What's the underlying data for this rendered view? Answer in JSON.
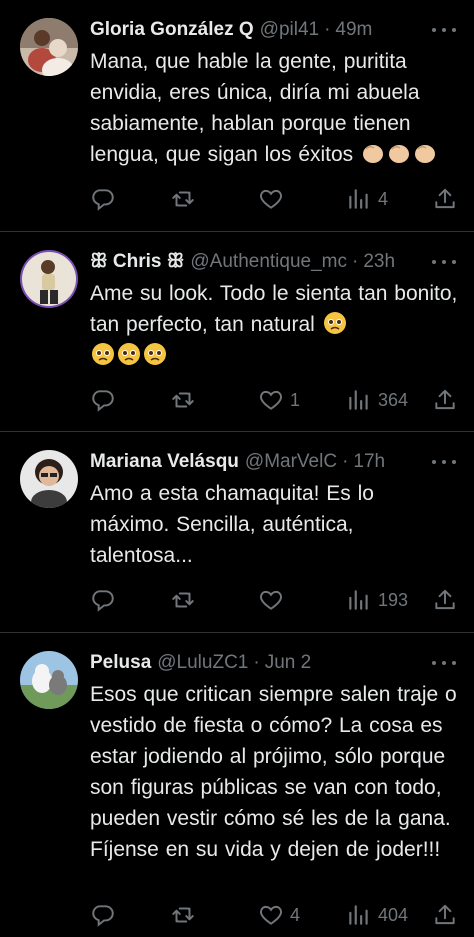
{
  "tweets": [
    {
      "name": "Gloria González Q",
      "handle": "@pil41",
      "time": "49m",
      "text": "Mana, que hable la gente, puritita envidia, eres única, diría mi abuela sabiamente, hablan porque tienen lengua, que sigan los éxitos",
      "emoji": [
        "clapping-hands",
        "clapping-hands",
        "clapping-hands"
      ],
      "replies": "",
      "retweets": "",
      "likes": "",
      "views": "4"
    },
    {
      "name": "ꕥ Chris ꕥ",
      "handle": "@Authentique_mc",
      "time": "23h",
      "text": "Ame su look. Todo le sienta tan bonito, tan perfecto, tan natural",
      "emoji": [
        "pleading-face",
        "pleading-face",
        "pleading-face",
        "pleading-face"
      ],
      "replies": "",
      "retweets": "",
      "likes": "1",
      "views": "364"
    },
    {
      "name": "Mariana Velásqu",
      "handle": "@MarVelC",
      "time": "17h",
      "text": "Amo a esta chamaquita! Es lo máximo. Sencilla, auténtica, talentosa...",
      "emoji": [],
      "replies": "",
      "retweets": "",
      "likes": "",
      "views": "193"
    },
    {
      "name": "Pelusa",
      "handle": "@LuluZC1",
      "time": "Jun 2",
      "text": "Esos que critican siempre salen traje o vestido de fiesta o cómo? La cosa es estar jodiendo al prójimo, sólo porque son figuras públicas se van con todo, pueden vestir cómo sé les de la gana. Fíjense en su vida y dejen de joder!!!",
      "emoji": [],
      "replies": "",
      "retweets": "",
      "likes": "4",
      "views": "404"
    }
  ],
  "colors": {
    "background": "#000000",
    "text": "#e7e9ea",
    "muted": "#71767b",
    "divider": "#2f3336"
  },
  "icons": [
    "reply-icon",
    "retweet-icon",
    "like-icon",
    "views-icon",
    "share-icon",
    "more-icon"
  ]
}
